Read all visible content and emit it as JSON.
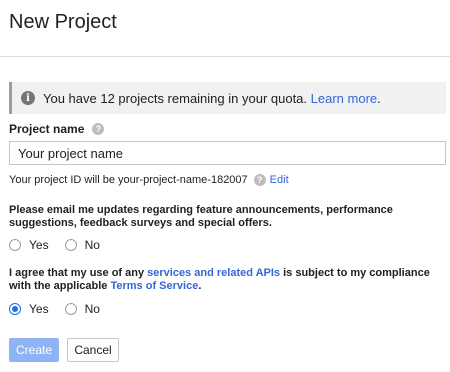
{
  "header": {
    "title": "New Project"
  },
  "info": {
    "text": "You have 12 projects remaining in your quota.",
    "link": "Learn more",
    "suffix": "."
  },
  "project_name": {
    "label": "Project name",
    "value": "Your project name"
  },
  "project_id": {
    "text": "Your project ID will be your-project-name-182007",
    "edit": "Edit"
  },
  "email_pref": {
    "question": "Please email me updates regarding feature announcements, performance suggestions, feedback surveys and special offers.",
    "yes": "Yes",
    "no": "No",
    "selected": "none"
  },
  "terms": {
    "pre": "I agree that my use of any ",
    "link1": "services and related APIs",
    "mid": " is subject to my compliance with the applicable ",
    "link2": "Terms of Service",
    "post": ".",
    "yes": "Yes",
    "no": "No",
    "selected": "yes"
  },
  "buttons": {
    "create": "Create",
    "cancel": "Cancel"
  },
  "colors": {
    "link": "#3367d6",
    "create_disabled": "#8fb4f3",
    "radio_active": "#1a73e8"
  }
}
